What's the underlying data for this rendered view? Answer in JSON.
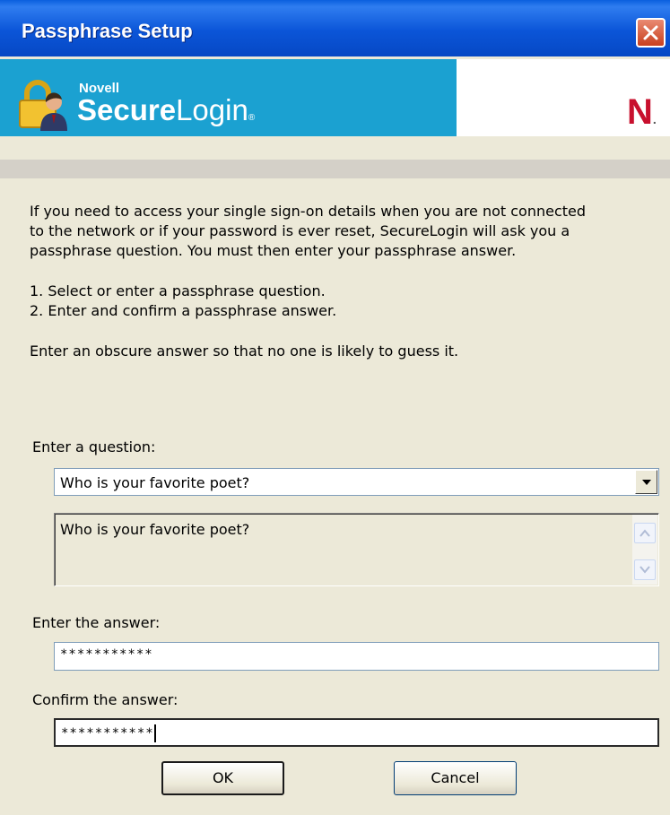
{
  "window": {
    "title": "Passphrase Setup",
    "close_icon": "close-icon"
  },
  "banner": {
    "brand": "Novell",
    "product_bold": "Secure",
    "product_light": "Login",
    "registered_mark": "®",
    "logo_letter": "N",
    "logo_dot": ".",
    "banner_color": "#1BA1D1",
    "logo_color": "#C8102E"
  },
  "intro": {
    "line1": "If you need to access your single sign-on details when you are not connected",
    "line2": "to the network or if your password is ever reset, SecureLogin will ask you a",
    "line3": "passphrase question. You must then enter your passphrase answer.",
    "step1": "1. Select or enter a passphrase question.",
    "step2": "2. Enter and confirm a passphrase answer.",
    "hint": "Enter an obscure answer so that no one is likely to guess it."
  },
  "question": {
    "label": "Enter a question:",
    "selected": "Who is your favorite poet?",
    "preview": "Who is your favorite poet?"
  },
  "answer": {
    "label": "Enter the answer:",
    "value": "***********"
  },
  "confirm": {
    "label": "Confirm the answer:",
    "value": "***********"
  },
  "buttons": {
    "ok": "OK",
    "cancel": "Cancel"
  }
}
